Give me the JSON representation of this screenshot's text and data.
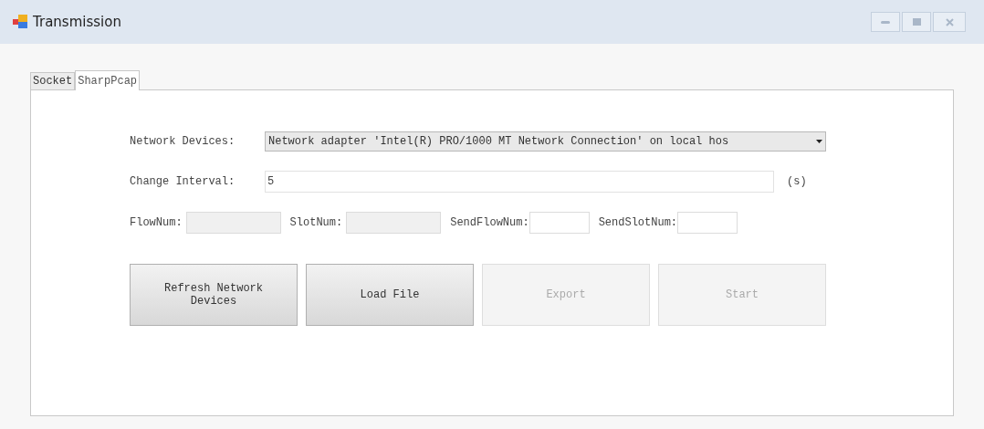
{
  "window": {
    "title": "Transmission"
  },
  "tabs": [
    {
      "label": "Socket",
      "selected": false
    },
    {
      "label": "SharpPcap",
      "selected": true
    }
  ],
  "network_devices": {
    "label": "Network Devices:",
    "value": "Network adapter 'Intel(R) PRO/1000 MT Network Connection' on local hos"
  },
  "change_interval": {
    "label": "Change Interval:",
    "value": "5",
    "unit": "(s)"
  },
  "counters": [
    {
      "label": "FlowNum:",
      "disabled": true
    },
    {
      "label": "SlotNum:",
      "disabled": true
    },
    {
      "label": "SendFlowNum:",
      "disabled": false
    },
    {
      "label": "SendSlotNum:",
      "disabled": false
    }
  ],
  "buttons": [
    {
      "label": "Refresh Network Devices",
      "disabled": false
    },
    {
      "label": "Load File",
      "disabled": false
    },
    {
      "label": "Export",
      "disabled": true
    },
    {
      "label": "Start",
      "disabled": true
    }
  ]
}
